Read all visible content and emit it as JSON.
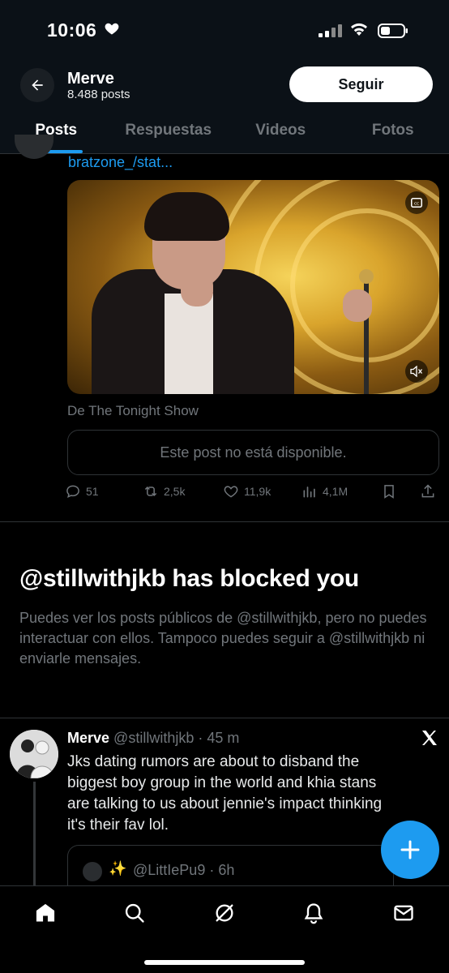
{
  "status_bar": {
    "time": "10:06",
    "heart_icon": "heart-icon",
    "signal_icon": "cellular-signal-icon",
    "wifi_icon": "wifi-icon",
    "battery_icon": "battery-icon"
  },
  "header": {
    "name": "Merve",
    "posts_count": "8.488 posts",
    "follow_label": "Seguir",
    "back_icon": "arrow-left-icon"
  },
  "tabs": [
    {
      "label": "Posts",
      "active": true
    },
    {
      "label": "Respuestas",
      "active": false
    },
    {
      "label": "Videos",
      "active": false
    },
    {
      "label": "Fotos",
      "active": false
    }
  ],
  "post1": {
    "link_text": "bratzone_/stat...",
    "media_source": "De The Tonight Show",
    "unavailable_text": "Este post no está disponible.",
    "actions": {
      "replies": "51",
      "reposts": "2,5k",
      "likes": "11,9k",
      "views": "4,1M"
    }
  },
  "blocked": {
    "title": "@stillwithjkb has blocked you",
    "description": "Puedes ver los posts públicos de @stillwithjkb, pero no puedes interactuar con ellos. Tampoco puedes seguir a @stillwithjkb ni enviarle mensajes."
  },
  "post2": {
    "name": "Merve",
    "handle_time": "@stillwithjkb · 45 m",
    "text": "Jks dating rumors are about to disband the biggest boy group in the world and khia stans are talking to us about jennie's impact thinking it's their fav lol.",
    "quote": {
      "sparkle": "✨",
      "handle_time": "@LittIePu9 · 6h"
    }
  },
  "fab_label": "+",
  "colors": {
    "accent": "#1d9bf0",
    "background": "#000000",
    "muted_text": "#71767b",
    "border": "#2f3336"
  }
}
